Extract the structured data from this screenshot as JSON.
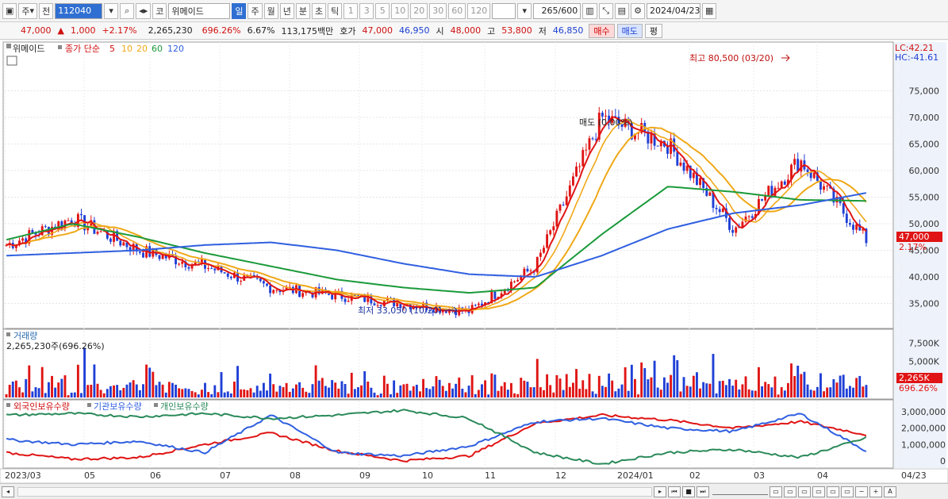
{
  "toolbar": {
    "mode_label": "주",
    "prev_label": "전",
    "code": "112040",
    "market_label": "코",
    "stock_name": "위메이드",
    "periods": [
      "일",
      "주",
      "월",
      "년",
      "분",
      "초",
      "틱"
    ],
    "period_selected": "일",
    "intervals": [
      "1",
      "3",
      "5",
      "10",
      "20",
      "30",
      "60",
      "120"
    ],
    "count": "265",
    "count_total": "/600",
    "date": "2024/04/23"
  },
  "quote": {
    "price": "47,000",
    "change_arrow": "▲",
    "change": "1,000",
    "change_pct": "+2.17%",
    "volume": "2,265,230",
    "volume_ratio": "696.26%",
    "turnover_pct": "6.67%",
    "amount": "113,175백만",
    "hoga_label": "호가",
    "ask": "47,000",
    "bid": "46,950",
    "open_label": "시",
    "open": "48,000",
    "high_label": "고",
    "high": "53,800",
    "low_label": "저",
    "low": "46,850",
    "buy_label": "매수",
    "sell_label": "매도",
    "eval_label": "평"
  },
  "legend": {
    "name": "위메이드",
    "ma_label": "종가 단순",
    "ma_periods": [
      "5",
      "10",
      "20",
      "60",
      "120"
    ],
    "lc": "LC:42.21",
    "hc": "HC:-41.61"
  },
  "annotations": {
    "high": "최고 80,500 (03/20)",
    "low": "최저 33,050 (10/20)",
    "sell_marker": "매도 (0.00%)",
    "price_tag": "47,000",
    "price_tag_pct": "2.17%"
  },
  "volume_panel": {
    "title": "거래량",
    "value": "2,265,230주(696.26%)",
    "tag": "2,265K",
    "tag_pct": "696.26%"
  },
  "holdings_panel": {
    "foreign": "외국인보유수량",
    "inst": "기관보유수량",
    "indiv": "개인보유수량"
  },
  "x_labels": [
    "2023/03",
    "05",
    "06",
    "07",
    "08",
    "09",
    "10",
    "11",
    "12",
    "2024/01",
    "02",
    "03",
    "04",
    "04/23"
  ],
  "colors": {
    "up": "#e01414",
    "down": "#1f3fd6",
    "ma5": "#e01414",
    "ma10": "#f0a818",
    "ma20": "#f0a818",
    "ma60": "#1a9a3a",
    "ma120": "#2f5fe0",
    "foreign": "#e01414",
    "inst": "#2f5fe0",
    "indiv": "#2a8a5a"
  },
  "chart_data": [
    {
      "type": "candlestick",
      "title": "위메이드",
      "y_ticks": [
        35000,
        40000,
        45000,
        50000,
        55000,
        60000,
        65000,
        70000,
        75000
      ],
      "y_tick_labels": [
        "35,000",
        "40,000",
        "45,000",
        "50,000",
        "55,000",
        "60,000",
        "65,000",
        "70,000",
        "75,000"
      ],
      "ylim": [
        31500,
        81500
      ],
      "dates": [
        "2023/03",
        "2023/04",
        "2023/05",
        "2023/06",
        "2023/07",
        "2023/08",
        "2023/09",
        "2023/10",
        "2023/11",
        "2023/12",
        "2024/01",
        "2024/02",
        "2024/03",
        "2024/04/23"
      ],
      "close_approx": [
        46000,
        51000,
        45000,
        42000,
        38000,
        36500,
        35000,
        33500,
        42000,
        70000,
        65000,
        49000,
        62000,
        47000
      ],
      "ma120_approx": [
        44000,
        44500,
        45000,
        46000,
        46500,
        45000,
        42500,
        40500,
        40000,
        44000,
        49000,
        52000,
        53500,
        55800
      ],
      "ma60_approx": [
        47000,
        50000,
        47500,
        44500,
        42000,
        39500,
        38000,
        37000,
        38000,
        48000,
        57000,
        56000,
        54500,
        54300
      ],
      "max": {
        "value": 80500,
        "date": "03/20"
      },
      "min": {
        "value": 33050,
        "date": "10/20"
      }
    },
    {
      "type": "bar",
      "title": "거래량",
      "y_ticks": [
        2500000,
        5000000,
        7500000
      ],
      "y_tick_labels": [
        "2,500K",
        "5,000K",
        "7,500K"
      ],
      "ylim": [
        0,
        9000000
      ],
      "last": 2265230
    },
    {
      "type": "line",
      "y_ticks": [
        0,
        1000000,
        2000000,
        3000000
      ],
      "y_tick_labels": [
        "0",
        "1,000,000",
        "2,000,000",
        "3,000,000"
      ],
      "ylim": [
        -300000,
        3300000
      ],
      "series": [
        {
          "name": "외국인보유수량",
          "values": [
            500000,
            100000,
            200000,
            1000000,
            1700000,
            600000,
            0,
            300000,
            2300000,
            2800000,
            2500000,
            2000000,
            2400000,
            1600000
          ]
        },
        {
          "name": "기관보유수량",
          "values": [
            1300000,
            1000000,
            1200000,
            500000,
            2800000,
            500000,
            300000,
            900000,
            2400000,
            2600000,
            2000000,
            1800000,
            2900000,
            600000
          ]
        },
        {
          "name": "개인보유수량",
          "values": [
            2800000,
            2900000,
            2700000,
            2900000,
            2600000,
            2800000,
            3100000,
            2600000,
            500000,
            -200000,
            500000,
            700000,
            200000,
            1400000
          ]
        }
      ]
    }
  ]
}
